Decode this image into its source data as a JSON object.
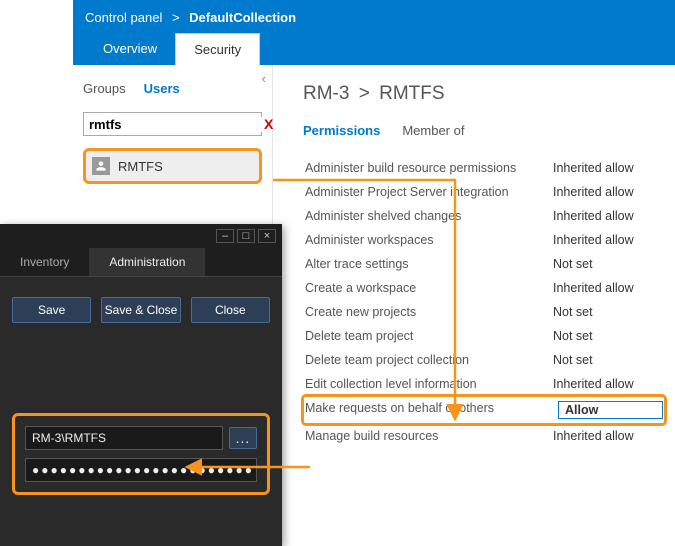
{
  "colors": {
    "accent": "#007acc",
    "highlight": "#f7941e"
  },
  "breadcrumb": {
    "root": "Control panel",
    "sep": ">",
    "current": "DefaultCollection"
  },
  "tfs_tabs": {
    "overview": "Overview",
    "security": "Security"
  },
  "left": {
    "collapse_glyph": "‹",
    "subtabs": {
      "groups": "Groups",
      "users": "Users"
    },
    "search": {
      "value": "rmtfs",
      "clear_glyph": "X"
    },
    "user": {
      "label": "RMTFS"
    }
  },
  "right": {
    "breadcrumb_root": "RM-3",
    "breadcrumb_sep": ">",
    "breadcrumb_leaf": "RMTFS",
    "subtabs": {
      "permissions": "Permissions",
      "member_of": "Member of"
    },
    "permissions": [
      {
        "label": "Administer build resource permissions",
        "value": "Inherited allow"
      },
      {
        "label": "Administer Project Server integration",
        "value": "Inherited allow"
      },
      {
        "label": "Administer shelved changes",
        "value": "Inherited allow"
      },
      {
        "label": "Administer workspaces",
        "value": "Inherited allow"
      },
      {
        "label": "Alter trace settings",
        "value": "Not set"
      },
      {
        "label": "Create a workspace",
        "value": "Inherited allow"
      },
      {
        "label": "Create new projects",
        "value": "Not set"
      },
      {
        "label": "Delete team project",
        "value": "Not set"
      },
      {
        "label": "Delete team project collection",
        "value": "Not set"
      },
      {
        "label": "Edit collection level information",
        "value": "Inherited allow"
      },
      {
        "label": "Make requests on behalf of others",
        "value": "Allow",
        "highlight": true
      },
      {
        "label": "Manage build resources",
        "value": "Inherited allow"
      }
    ]
  },
  "darkwin": {
    "controls": {
      "min": "–",
      "max": "□",
      "close": "×"
    },
    "tabs": {
      "inventory": "Inventory",
      "administration": "Administration"
    },
    "actions": {
      "save": "Save",
      "save_close": "Save & Close",
      "close": "Close"
    },
    "form": {
      "account": "RM-3\\RMTFS",
      "browse_glyph": "...",
      "password_mask": "●●●●●●●●●●●●●●●●●●●●●●●●"
    }
  }
}
